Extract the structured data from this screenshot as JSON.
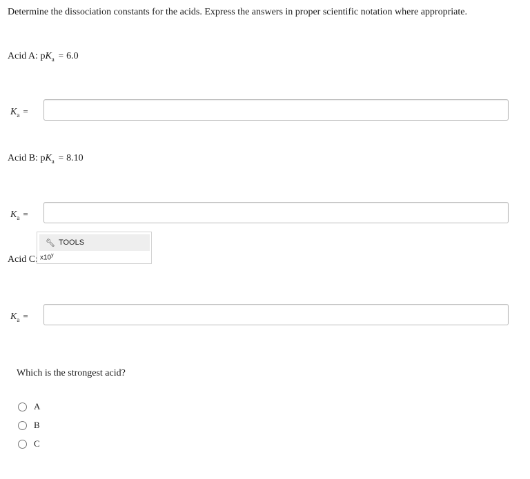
{
  "instructions": "Determine the dissociation constants for the acids. Express the answers in proper scientific notation where appropriate.",
  "acids": [
    {
      "prefix": "Acid A: p",
      "symbol": "K",
      "sub": "a",
      "eq": "=",
      "value": "6.0"
    },
    {
      "prefix": "Acid B: p",
      "symbol": "K",
      "sub": "a",
      "eq": "=",
      "value": "8.10"
    },
    {
      "prefix": "Acid C:"
    }
  ],
  "ka_label": {
    "symbol": "K",
    "sub": "a",
    "eq": "="
  },
  "answers": [
    {
      "value": "",
      "placeholder": ""
    },
    {
      "value": "",
      "placeholder": ""
    },
    {
      "value": "",
      "placeholder": ""
    }
  ],
  "tools": {
    "icon": "wrench-icon",
    "label": "TOOLS",
    "x10_base": "x10",
    "x10_exp": "y"
  },
  "question": "Which is the strongest acid?",
  "options": [
    {
      "label": "A",
      "selected": false
    },
    {
      "label": "B",
      "selected": false
    },
    {
      "label": "C",
      "selected": false
    }
  ]
}
